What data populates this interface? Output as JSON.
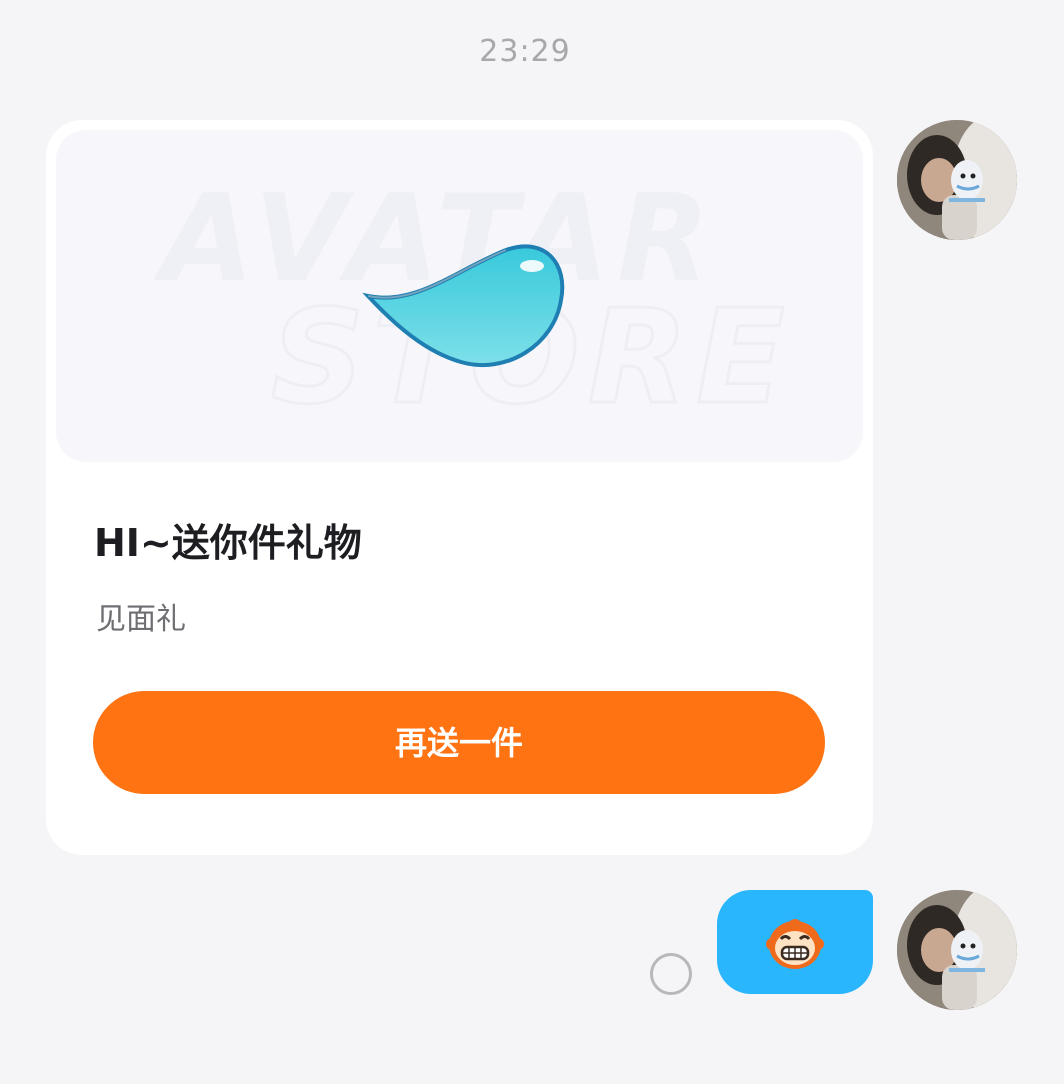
{
  "chat": {
    "timestamp": "23:29"
  },
  "gift_card": {
    "image_watermark_line1": "AVATAR",
    "image_watermark_line2": "STORE",
    "image_icon": "water-drop-icon",
    "title": "HI~送你件礼物",
    "subtitle": "见面礼",
    "button_label": "再送一件"
  },
  "emoji_message": {
    "sticker": "grinning-monkey-sticker",
    "bubble_color": "#29b6fc"
  },
  "colors": {
    "accent": "#ff7313",
    "bubble_blue": "#29b6fc",
    "background": "#f5f5f7"
  }
}
